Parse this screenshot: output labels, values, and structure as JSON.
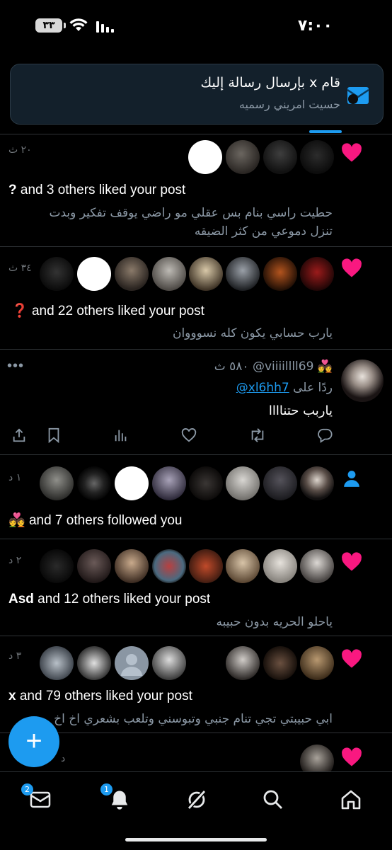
{
  "status_bar": {
    "time": "٧:٠٠",
    "battery": "٣٣"
  },
  "banner": {
    "title": "قام x بإرسال رسالة إليك",
    "subtitle": "حسيت امريني رسميه"
  },
  "notifications": [
    {
      "type": "like",
      "time": "٢٠ ث",
      "actor": "?",
      "rest": " and 3 others liked your post",
      "quote": [
        "حطيت راسي بنام بس عقلي مو راضي يوقف تفكير وبدت",
        "تنزل دموعي من كثر الضيقه"
      ]
    },
    {
      "type": "like",
      "time": "٣٤ ث",
      "actor": "❓",
      "rest": " and 22 others liked your post",
      "quote": [
        "يارب حسابي يكون كله نسوووان"
      ]
    },
    {
      "type": "follow",
      "time": "١ د",
      "actor": "💑",
      "rest": " and 7 others followed you"
    },
    {
      "type": "like",
      "time": "٢ د",
      "actor": "Asd",
      "rest": " and 12 others liked your post",
      "quote": [
        "ياحلو الحريه بدون حبيبه"
      ]
    },
    {
      "type": "like",
      "time": "٣ د",
      "actor": "x",
      "rest": " and 79 others liked your post",
      "quote": [
        "ابي حبيبتي تجي تنام جنبي وتبوسني وتلعب بشعري اخ اخ"
      ]
    },
    {
      "type": "like",
      "time": "د"
    }
  ],
  "reply_post": {
    "handle": "@viiiillll69",
    "emoji": "💑",
    "time": "٥٨٠ ث",
    "reply_prefix": "ردًا على",
    "reply_to": "@xl6hh7",
    "text": "ياربب حتناااا",
    "more": "•••"
  },
  "fab_label": "+",
  "tabbar": {
    "messages_badge": "2",
    "notifications_badge": "1",
    "items": [
      "messages-icon",
      "notifications-icon",
      "grok-icon",
      "search-icon",
      "home-icon"
    ]
  },
  "colors": {
    "accent": "#1d9bf0",
    "heart": "#f91880",
    "muted": "#71767b"
  }
}
